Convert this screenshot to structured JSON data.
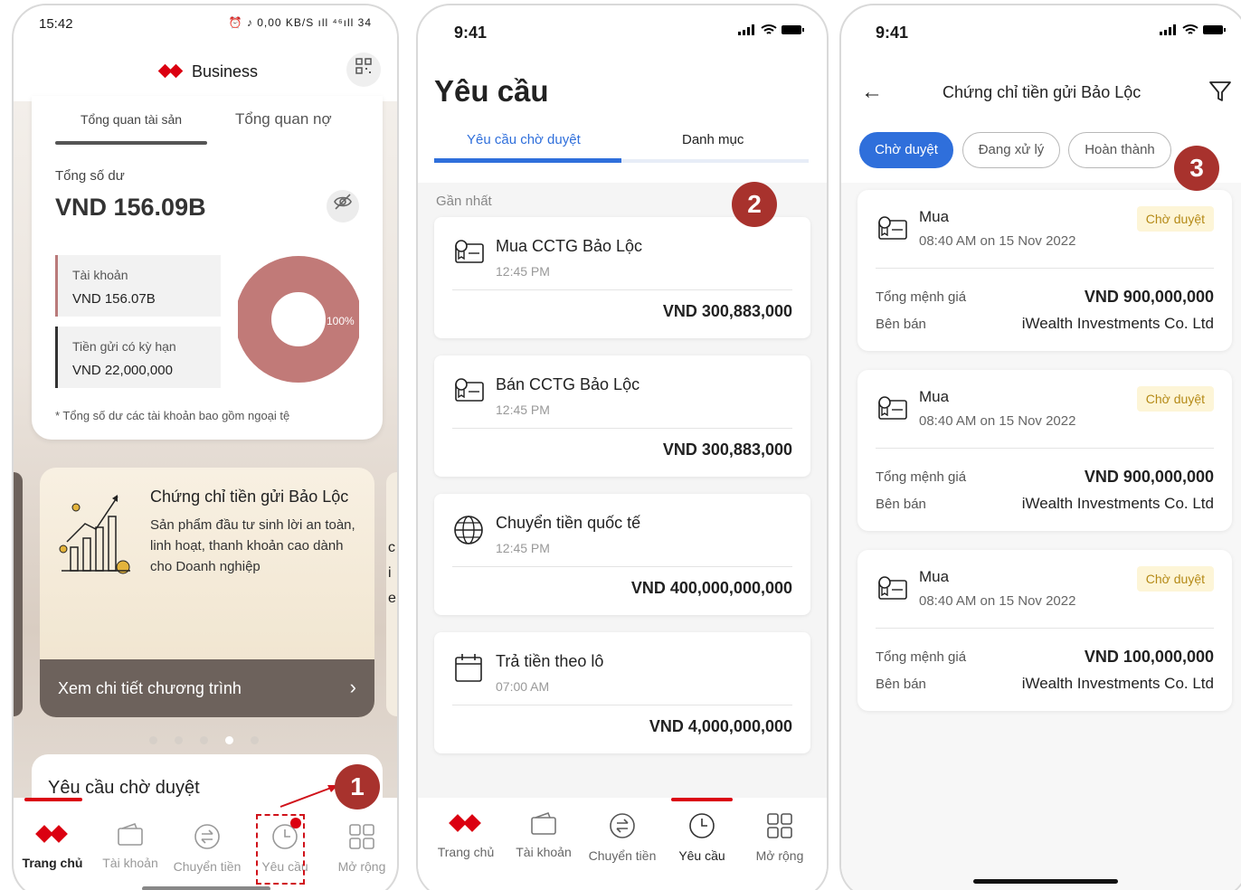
{
  "phone1": {
    "status_time": "15:42",
    "status_icons": "⏰ ♪ 0,00 KB/S ıll ⁴⁶ıll 34",
    "brand": "Business",
    "tabs": {
      "assets": "Tổng quan tài sản",
      "debt": "Tổng quan nợ"
    },
    "total_label": "Tổng số dư",
    "total_value": "VND 156.09B",
    "accounts": [
      {
        "label": "Tài khoản",
        "value": "VND 156.07B"
      },
      {
        "label": "Tiền gửi có kỳ hạn",
        "value": "VND 22,000,000"
      }
    ],
    "donut_percent": "100%",
    "footnote": "* Tổng số dư các tài khoản bao gồm ngoại tệ",
    "promo": {
      "title": "Chứng chỉ tiền gửi Bảo Lộc",
      "description": "Sản phẩm đầu tư sinh lời an toàn, linh hoạt, thanh khoản cao dành cho Doanh nghiệp",
      "cta": "Xem chi tiết chương trình",
      "peek_text": "c\ni\ne"
    },
    "carousel_active_index": 3,
    "pending_title": "Yêu cầu chờ duyệt",
    "nav": [
      {
        "label": "Trang chủ",
        "active": true
      },
      {
        "label": "Tài khoản",
        "active": false
      },
      {
        "label": "Chuyển tiền",
        "active": false
      },
      {
        "label": "Yêu cầu",
        "active": false
      },
      {
        "label": "Mở rộng",
        "active": false
      }
    ]
  },
  "phone2": {
    "status_time": "9:41",
    "title": "Yêu cầu",
    "tabs": [
      "Yêu cầu chờ duyệt",
      "Danh mục"
    ],
    "section_label": "Gần nhất",
    "requests": [
      {
        "title": "Mua CCTG Bảo Lộc",
        "time": "12:45 PM",
        "amount": "VND 300,883,000",
        "icon": "certificate-icon"
      },
      {
        "title": "Bán CCTG Bảo Lộc",
        "time": "12:45 PM",
        "amount": "VND 300,883,000",
        "icon": "certificate-icon"
      },
      {
        "title": "Chuyển tiền quốc tế",
        "time": "12:45 PM",
        "amount": "VND 400,000,000,000",
        "icon": "globe-icon"
      },
      {
        "title": "Trả tiền theo lô",
        "time": "07:00 AM",
        "amount": "VND 4,000,000,000",
        "icon": "calendar-icon"
      }
    ],
    "nav": [
      {
        "label": "Trang chủ"
      },
      {
        "label": "Tài khoản"
      },
      {
        "label": "Chuyển tiền"
      },
      {
        "label": "Yêu cầu"
      },
      {
        "label": "Mở rộng"
      }
    ]
  },
  "phone3": {
    "status_time": "9:41",
    "title": "Chứng chỉ tiền gửi Bảo Lộc",
    "chips": [
      "Chờ duyệt",
      "Đang xử lý",
      "Hoàn thành"
    ],
    "cards": [
      {
        "title": "Mua",
        "time": "08:40 AM on 15 Nov 2022",
        "badge": "Chờ duyệt",
        "label1": "Tổng mệnh giá",
        "value1": "VND 900,000,000",
        "label2": "Bên bán",
        "value2": "iWealth Investments Co. Ltd"
      },
      {
        "title": "Mua",
        "time": "08:40 AM on 15 Nov 2022",
        "badge": "Chờ duyệt",
        "label1": "Tổng mệnh giá",
        "value1": "VND 900,000,000",
        "label2": "Bên bán",
        "value2": "iWealth Investments Co. Ltd"
      },
      {
        "title": "Mua",
        "time": "08:40 AM on 15 Nov 2022",
        "badge": "Chờ duyệt",
        "label1": "Tổng mệnh giá",
        "value1": "VND 100,000,000",
        "label2": "Bên bán",
        "value2": "iWealth Investments Co. Ltd"
      }
    ]
  },
  "callouts": [
    "1",
    "2",
    "3"
  ],
  "colors": {
    "brand_red": "#db0011",
    "accent_blue": "#2f6fdb",
    "callout": "#a8322d",
    "badge_bg": "#fdf5d7",
    "badge_text": "#b58a17"
  }
}
